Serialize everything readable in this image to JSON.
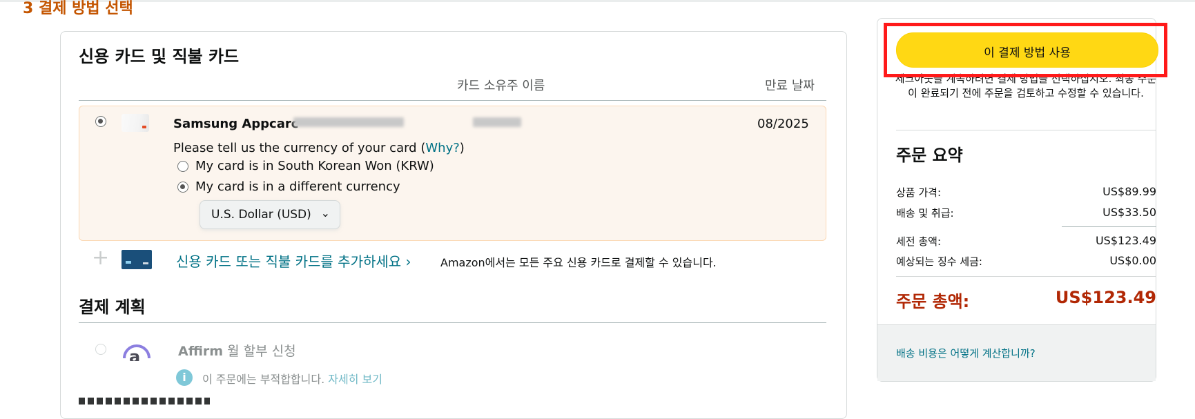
{
  "step": {
    "heading": "3 결제 방법 선택"
  },
  "cards_section": {
    "title": "신용 카드 및 직불 카드",
    "col_name": "카드 소유주 이름",
    "col_expiry": "만료 날짜",
    "card": {
      "name_prefix": "Samsung Appcarc",
      "expiry": "08/2025",
      "currency_prompt_pre": "Please tell us the currency of your card (",
      "currency_prompt_link": "Why?",
      "currency_prompt_post": ")",
      "option_krw": "My card is in South Korean Won (KRW)",
      "option_other": "My card is in a different currency",
      "currency_select": "U.S. Dollar (USD)"
    },
    "add_card_link": "신용 카드 또는 직불 카드를 추가하세요 ›",
    "add_card_note": "Amazon에서는 모든 주요 신용 카드로 결제할 수 있습니다."
  },
  "plan_section": {
    "title": "결제 계획",
    "affirm_brand": "Affirm",
    "affirm_label": " 월 할부 신청",
    "info_text": "이 주문에는 부적합합니다. ",
    "info_link": "자세히 보기"
  },
  "summary": {
    "use_button": "이 결제 방법 사용",
    "hint": "체크아웃을 계속하려면 결제 방법을 선택하십시오. 최종 주문이 완료되기 전에 주문을 검토하고 수정할 수 있습니다.",
    "title": "주문 요약",
    "items_label": "상품 가격:",
    "items_value": "US$89.99",
    "shipping_label": "배송 및 취급:",
    "shipping_value": "US$33.50",
    "pretax_label": "세전 총액:",
    "pretax_value": "US$123.49",
    "tax_label": "예상되는 징수 세금:",
    "tax_value": "US$0.00",
    "total_label": "주문 총액:",
    "total_value": "US$123.49",
    "shipping_link": "배송 비용은 어떻게 계산합니까?"
  },
  "colors": {
    "accent_orange": "#c45500",
    "button_yellow": "#ffd814",
    "price_red": "#b12704",
    "link_teal": "#007185",
    "highlight_red": "#ff1a1a"
  }
}
